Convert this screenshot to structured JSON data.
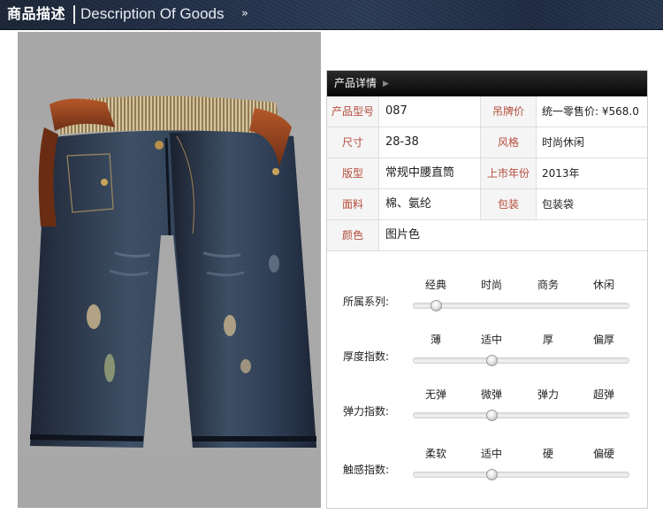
{
  "header": {
    "title": "商品描述",
    "subtitle": "Description Of Goods",
    "chevron_icon": "double-chevron-down-icon"
  },
  "photo": {
    "subject": "denim-shorts-with-brown-belt",
    "background_color": "#a7a7a7"
  },
  "details": {
    "title": "产品详情",
    "title_icon": "triangle-right-icon",
    "rows": [
      {
        "label": "产品型号",
        "value": "087",
        "label2": "吊牌价",
        "value2": "统一零售价: ¥568.0"
      },
      {
        "label": "尺寸",
        "value": "28-38",
        "label2": "风格",
        "value2": "时尚休闲"
      },
      {
        "label": "版型",
        "value": "常规中腰直筒",
        "label2": "上市年份",
        "value2": "2013年"
      },
      {
        "label": "面料",
        "value": "棉、氨纶",
        "label2": "包装",
        "value2": "包装袋"
      },
      {
        "label": "颜色",
        "value": "图片色"
      }
    ]
  },
  "attributes": [
    {
      "label": "所属系列:",
      "options": [
        "经典",
        "时尚",
        "商务",
        "休闲"
      ],
      "selected_index": 0
    },
    {
      "label": "厚度指数:",
      "options": [
        "薄",
        "适中",
        "厚",
        "偏厚"
      ],
      "selected_index": 1
    },
    {
      "label": "弹力指数:",
      "options": [
        "无弹",
        "微弹",
        "弹力",
        "超弹"
      ],
      "selected_index": 1
    },
    {
      "label": "触感指数:",
      "options": [
        "柔软",
        "适中",
        "硬",
        "偏硬"
      ],
      "selected_index": 1
    }
  ],
  "colors": {
    "label_text": "#b44c3c",
    "header_dark": "#060606",
    "denim_dark": "#1f2b3c"
  }
}
